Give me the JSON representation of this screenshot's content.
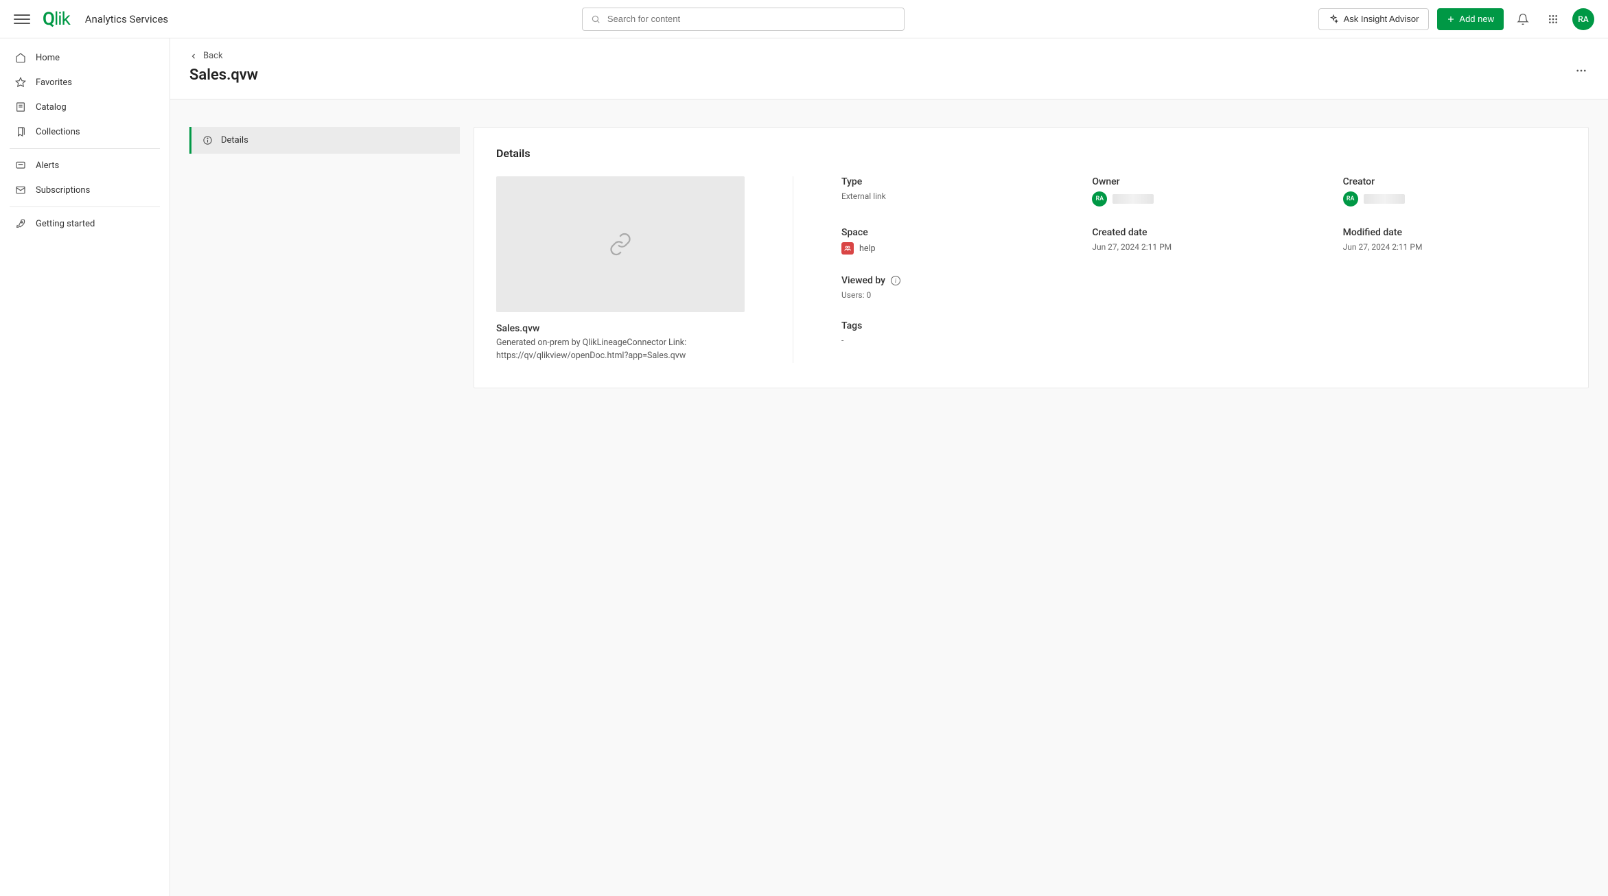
{
  "header": {
    "app_name": "Analytics Services",
    "search_placeholder": "Search for content",
    "ask_insight_label": "Ask Insight Advisor",
    "add_new_label": "Add new",
    "avatar_initials": "RA"
  },
  "sidebar": {
    "items": [
      {
        "label": "Home"
      },
      {
        "label": "Favorites"
      },
      {
        "label": "Catalog"
      },
      {
        "label": "Collections"
      },
      {
        "label": "Alerts"
      },
      {
        "label": "Subscriptions"
      },
      {
        "label": "Getting started"
      }
    ]
  },
  "page": {
    "back_label": "Back",
    "title": "Sales.qvw",
    "side_tab_label": "Details"
  },
  "details": {
    "heading": "Details",
    "file_name": "Sales.qvw",
    "description": "Generated on-prem by QlikLineageConnector Link: https://qv/qlikview/openDoc.html?app=Sales.qvw",
    "type_label": "Type",
    "type_value": "External link",
    "owner_label": "Owner",
    "owner_initials": "RA",
    "creator_label": "Creator",
    "creator_initials": "RA",
    "space_label": "Space",
    "space_value": "help",
    "created_label": "Created date",
    "created_value": "Jun 27, 2024 2:11 PM",
    "modified_label": "Modified date",
    "modified_value": "Jun 27, 2024 2:11 PM",
    "viewedby_label": "Viewed by",
    "viewedby_value": "Users: 0",
    "tags_label": "Tags",
    "tags_value": "-"
  }
}
